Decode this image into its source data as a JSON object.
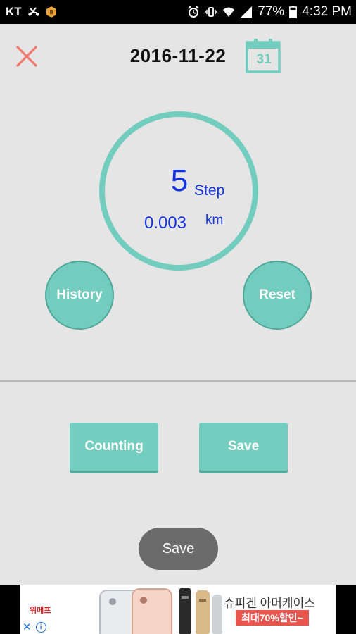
{
  "status_bar": {
    "carrier": "KT",
    "battery_percent": "77%",
    "time": "4:32 PM",
    "icons": [
      "missed-call-icon",
      "app-notification-icon",
      "alarm-icon",
      "vibrate-icon",
      "wifi-icon",
      "signal-icon",
      "battery-icon"
    ]
  },
  "header": {
    "date": "2016-11-22",
    "calendar_day": "31",
    "close_icon": "close-icon"
  },
  "counter": {
    "steps": "5",
    "step_unit": "Step",
    "distance": "0.003",
    "distance_unit": "km"
  },
  "actions": {
    "history_label": "History",
    "reset_label": "Reset",
    "counting_label": "Counting",
    "save_label": "Save"
  },
  "toast": {
    "message": "Save"
  },
  "ad": {
    "brand": "위메프",
    "title": "슈피겐 아머케이스",
    "promo": "최대70%할인~"
  },
  "colors": {
    "accent": "#73cdbf",
    "value_text": "#1433e0",
    "close": "#f07a6e"
  }
}
